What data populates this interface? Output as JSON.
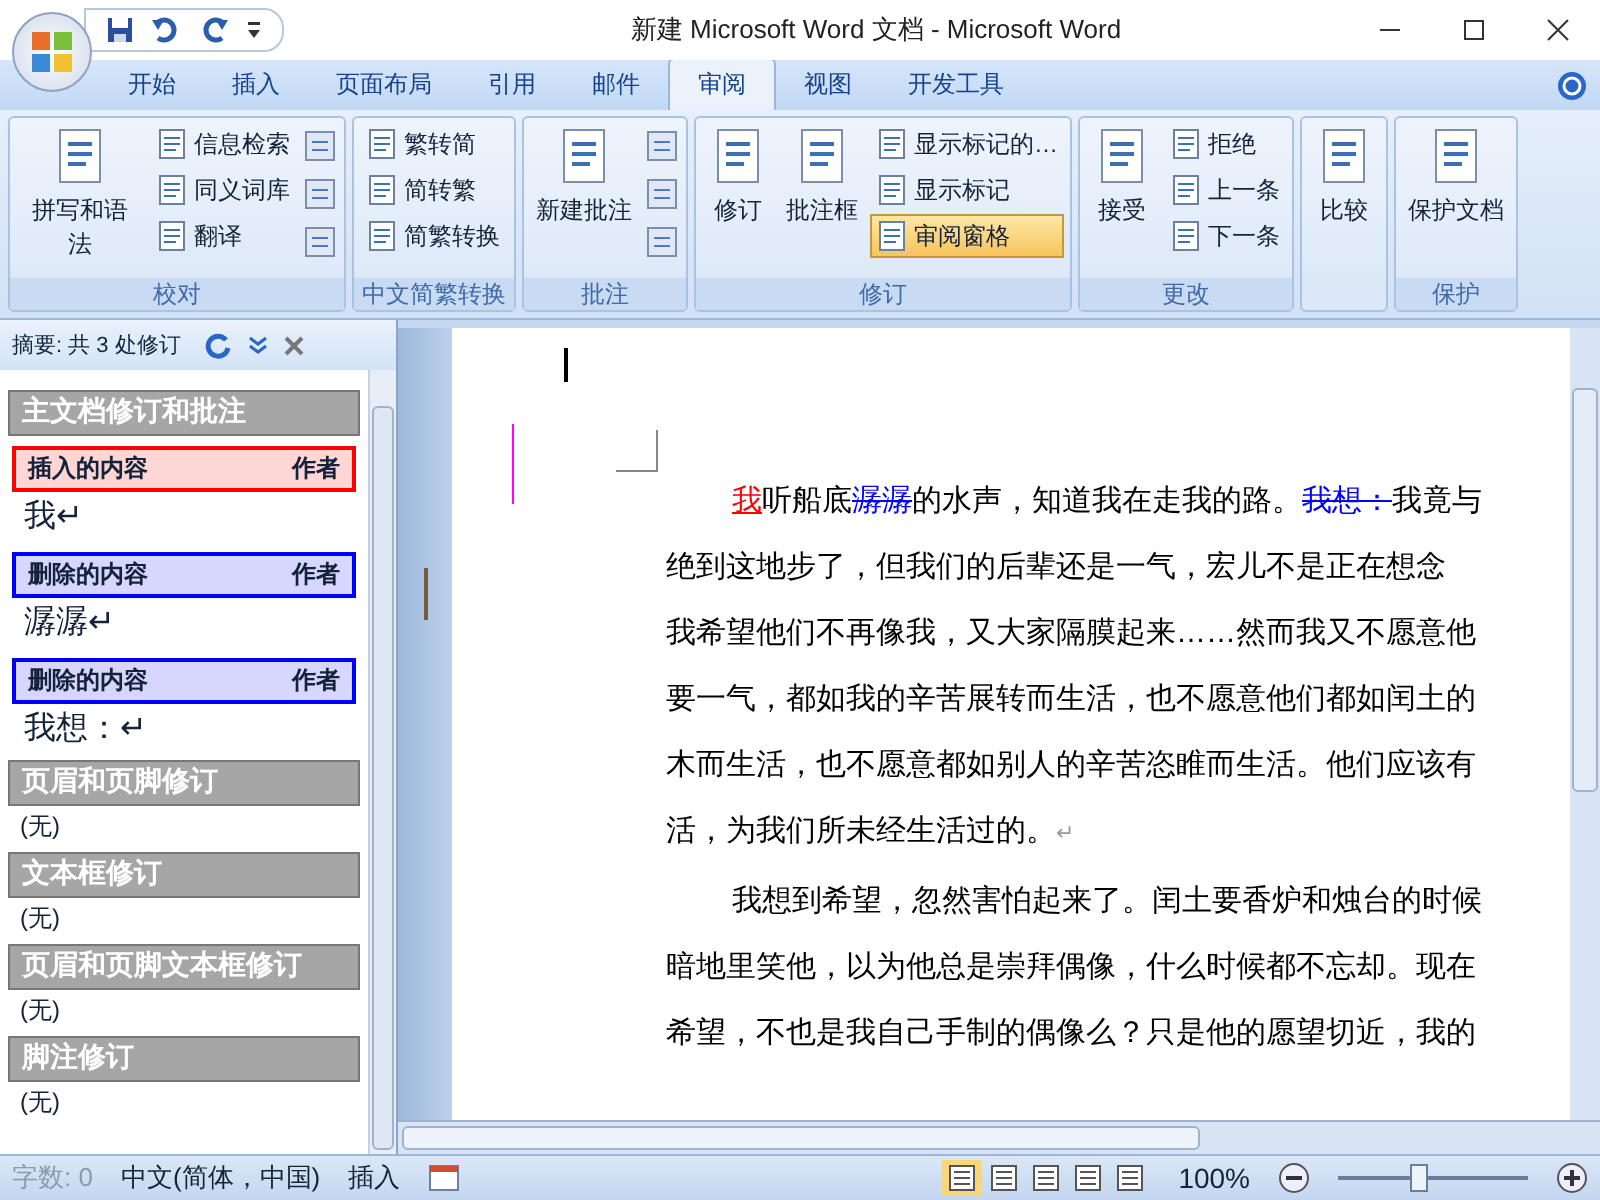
{
  "window": {
    "title": "新建 Microsoft Word 文档 - Microsoft Word"
  },
  "tabs": [
    {
      "label": "开始",
      "selected": false
    },
    {
      "label": "插入",
      "selected": false
    },
    {
      "label": "页面布局",
      "selected": false
    },
    {
      "label": "引用",
      "selected": false
    },
    {
      "label": "邮件",
      "selected": false
    },
    {
      "label": "审阅",
      "selected": true
    },
    {
      "label": "视图",
      "selected": false
    },
    {
      "label": "开发工具",
      "selected": false
    }
  ],
  "ribbon_groups": [
    {
      "label": "校对",
      "items": [
        {
          "kind": "large",
          "label": "拼写和语法"
        },
        {
          "kind": "small",
          "label": "信息检索"
        },
        {
          "kind": "small",
          "label": "同义词库"
        },
        {
          "kind": "small",
          "label": "翻译"
        },
        {
          "kind": "icon"
        },
        {
          "kind": "icon"
        },
        {
          "kind": "icon"
        }
      ]
    },
    {
      "label": "中文简繁转换",
      "items": [
        {
          "kind": "small",
          "label": "繁转简"
        },
        {
          "kind": "small",
          "label": "简转繁"
        },
        {
          "kind": "small",
          "label": "简繁转换"
        }
      ]
    },
    {
      "label": "批注",
      "items": [
        {
          "kind": "large",
          "label": "新建批注"
        },
        {
          "kind": "icon"
        },
        {
          "kind": "icon"
        },
        {
          "kind": "icon"
        }
      ]
    },
    {
      "label": "修订",
      "items": [
        {
          "kind": "large",
          "label": "修订"
        },
        {
          "kind": "large",
          "label": "批注框"
        },
        {
          "kind": "small",
          "label": "显示标记的…"
        },
        {
          "kind": "small",
          "label": "显示标记"
        },
        {
          "kind": "small",
          "label": "审阅窗格",
          "selected": true
        }
      ]
    },
    {
      "label": "更改",
      "items": [
        {
          "kind": "large",
          "label": "接受"
        },
        {
          "kind": "small",
          "label": "拒绝"
        },
        {
          "kind": "small",
          "label": "上一条"
        },
        {
          "kind": "small",
          "label": "下一条"
        }
      ]
    },
    {
      "items": [
        {
          "kind": "large",
          "label": "比较"
        }
      ]
    },
    {
      "label": "保护",
      "items": [
        {
          "kind": "large",
          "label": "保护文档"
        }
      ]
    }
  ],
  "review_pane": {
    "summary": "摘要: 共 3 处修订",
    "entries": [
      {
        "kind": "section",
        "label": "主文档修订和批注"
      },
      {
        "kind": "insert",
        "label": "插入的内容",
        "author": "作者",
        "text": "我↵"
      },
      {
        "kind": "delete",
        "label": "删除的内容",
        "author": "作者",
        "text": "潺潺↵"
      },
      {
        "kind": "delete",
        "label": "删除的内容",
        "author": "作者",
        "text": "我想：↵"
      },
      {
        "kind": "section",
        "label": "页眉和页脚修订"
      },
      {
        "kind": "none",
        "text": "(无)"
      },
      {
        "kind": "section",
        "label": "文本框修订"
      },
      {
        "kind": "none",
        "text": "(无)"
      },
      {
        "kind": "section",
        "label": "页眉和页脚文本框修订"
      },
      {
        "kind": "none",
        "text": "(无)"
      },
      {
        "kind": "section",
        "label": "脚注修订"
      },
      {
        "kind": "none",
        "text": "(无)"
      }
    ]
  },
  "document": {
    "lines": [
      {
        "indent": true,
        "changed": true,
        "segments": [
          {
            "kind": "insert",
            "text": "我"
          },
          {
            "kind": "plain",
            "text": "听船底"
          },
          {
            "kind": "delete",
            "text": "潺潺"
          },
          {
            "kind": "plain",
            "text": "的水声，知道我在走我的路。"
          },
          {
            "kind": "delete",
            "text": "我想："
          },
          {
            "kind": "plain",
            "text": "我竟与"
          }
        ]
      },
      {
        "indent": false,
        "changed": false,
        "segments": [
          {
            "kind": "plain",
            "text": "绝到这地步了，但我们的后辈还是一气，宏儿不是正在想念"
          }
        ]
      },
      {
        "indent": false,
        "changed": false,
        "segments": [
          {
            "kind": "plain",
            "text": "我希望他们不再像我，又大家隔膜起来……然而我又不愿意他"
          }
        ]
      },
      {
        "indent": false,
        "changed": false,
        "segments": [
          {
            "kind": "plain",
            "text": "要一气，都如我的辛苦展转而生活，也不愿意他们都如闰土的"
          }
        ]
      },
      {
        "indent": false,
        "changed": false,
        "segments": [
          {
            "kind": "plain",
            "text": "木而生活，也不愿意都如别人的辛苦恣睢而生活。他们应该有"
          }
        ]
      },
      {
        "indent": false,
        "changed": false,
        "segments": [
          {
            "kind": "plain",
            "text": "活，为我们所未经生活过的。"
          },
          {
            "kind": "mark",
            "text": "↵"
          }
        ]
      },
      {
        "indent": true,
        "changed": false,
        "segments": [
          {
            "kind": "plain",
            "text": "我想到希望，忽然害怕起来了。闰土要香炉和烛台的时候"
          }
        ]
      },
      {
        "indent": false,
        "changed": false,
        "segments": [
          {
            "kind": "plain",
            "text": "暗地里笑他，以为他总是崇拜偶像，什么时候都不忘却。现在"
          }
        ]
      },
      {
        "indent": false,
        "changed": false,
        "segments": [
          {
            "kind": "plain",
            "text": "希望，不也是我自己手制的偶像么？只是他的愿望切近，我的"
          }
        ]
      }
    ]
  },
  "status_bar": {
    "items": [
      {
        "text": "字数: 0",
        "disabled": true
      },
      {
        "text": "中文(简体，中国)",
        "disabled": false
      },
      {
        "text": "插入",
        "disabled": false
      }
    ],
    "zoom": "100%",
    "zoom_slider": {
      "level": 0.42
    }
  }
}
